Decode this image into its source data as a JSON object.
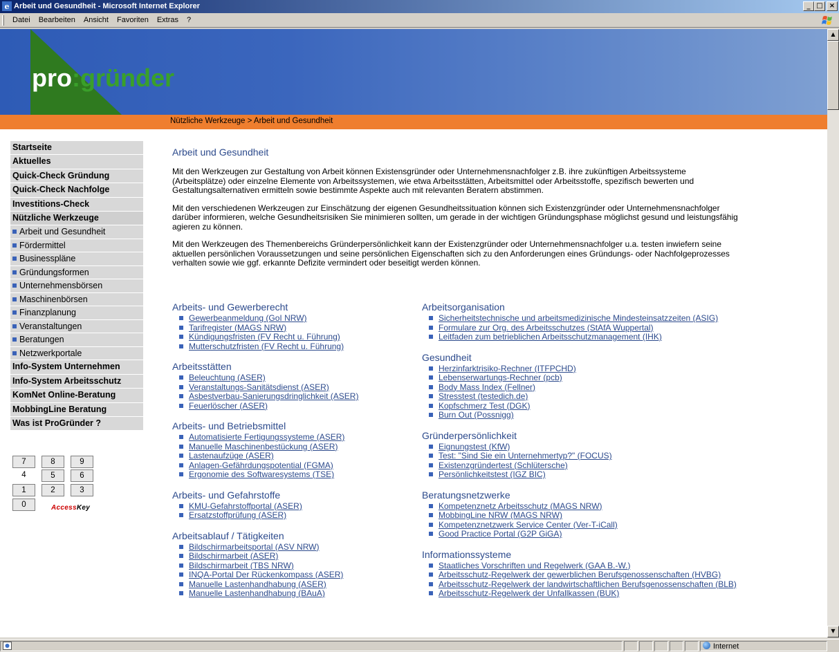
{
  "window": {
    "title": "Arbeit und Gesundheit - Microsoft Internet Explorer",
    "min": "_",
    "max": "□",
    "close": "×"
  },
  "menu": [
    "Datei",
    "Bearbeiten",
    "Ansicht",
    "Favoriten",
    "Extras",
    "?"
  ],
  "logo": {
    "pro": "pro",
    "rest": ":gründer"
  },
  "breadcrumb": "Nützliche Werkzeuge > Arbeit und Gesundheit",
  "nav": {
    "top1": [
      "Startseite",
      "Aktuelles",
      "Quick-Check Gründung",
      "Quick-Check Nachfolge",
      "Investitions-Check",
      "Nützliche Werkzeuge"
    ],
    "sub": [
      "Arbeit und Gesundheit",
      "Fördermittel",
      "Businesspläne",
      "Gründungsformen",
      "Unternehmensbörsen",
      "Maschinenbörsen",
      "Finanzplanung",
      "Veranstaltungen",
      "Beratungen",
      "Netzwerkportale"
    ],
    "top2": [
      "Info-System Unternehmen",
      "Info-System Arbeitsschutz",
      "KomNet Online-Beratung",
      "MobbingLine Beratung",
      "Was ist ProGründer ?"
    ]
  },
  "keypad": {
    "keys": [
      "7",
      "8",
      "9",
      "4",
      "5",
      "6",
      "1",
      "2",
      "3",
      "0"
    ],
    "label_a": "Access",
    "label_k": "Key"
  },
  "main": {
    "heading": "Arbeit und Gesundheit",
    "paragraphs": [
      "Mit den Werkzeugen zur Gestaltung von Arbeit können Existensgründer oder Unternehmensnachfolger z.B. ihre zukünftigen Arbeitssysteme (Arbeitsplätze) oder einzelne Elemente von Arbeitssystemen, wie etwa Arbeitsstätten, Arbeitsmittel oder Arbeitsstoffe, spezifisch bewerten und Gestaltungsalternativen ermitteln sowie bestimmte Aspekte auch mit relevanten Beratern abstimmen.",
      "Mit den verschiedenen Werkzeugen zur Einschätzung der eigenen Gesundheitssituation können sich Existenzgründer oder Unternehmensnachfolger darüber informieren, welche Gesundheitsrisiken Sie minimieren sollten, um gerade in der wichtigen Gründungsphase möglichst gesund und leistungsfähig agieren zu können.",
      "Mit den Werkzeugen des Themenbereichs Gründerpersönlichkeit kann der Existenzgründer oder Unternehmensnachfolger u.a. testen inwiefern seine aktuellen persönlichen Voraussetzungen und seine persönlichen Eigenschaften sich zu den Anforderungen eines Gründungs- oder Nachfolgeprozesses verhalten sowie wie ggf. erkannte Defizite vermindert oder beseitigt werden können."
    ],
    "left_sections": [
      {
        "title": "Arbeits- und Gewerberecht",
        "links": [
          "Gewerbeanmeldung (GoI NRW)",
          "Tarifregister (MAGS NRW)",
          "Kündigungsfristen (FV Recht u. Führung)",
          "Mutterschutzfristen (FV Recht u. Führung)"
        ]
      },
      {
        "title": "Arbeitsstätten",
        "links": [
          "Beleuchtung (ASER)",
          "Veranstaltungs-Sanitätsdienst (ASER)",
          "Asbestverbau-Sanierungsdringlichkeit (ASER)",
          "Feuerlöscher (ASER)"
        ]
      },
      {
        "title": "Arbeits- und Betriebsmittel",
        "links": [
          "Automatisierte Fertigungssysteme (ASER)",
          "Manuelle Maschinenbestückung (ASER)",
          "Lastenaufzüge (ASER)",
          "Anlagen-Gefährdungspotential (FGMA)",
          "Ergonomie des Softwaresystems (TSE)"
        ]
      },
      {
        "title": "Arbeits- und Gefahrstoffe",
        "links": [
          "KMU-Gefahrstoffportal (ASER)",
          "Ersatzstoffprüfung (ASER)"
        ]
      },
      {
        "title": "Arbeitsablauf / Tätigkeiten",
        "links": [
          "Bildschirmarbeitsportal (ASV NRW)",
          "Bildschirmarbeit (ASER)",
          "Bildschirmarbeit (TBS NRW)",
          "INQA-Portal Der Rückenkompass (ASER)",
          "Manuelle Lastenhandhabung (ASER)",
          "Manuelle Lastenhandhabung (BAuA)"
        ]
      }
    ],
    "right_sections": [
      {
        "title": "Arbeitsorganisation",
        "links": [
          "Sicherheitstechnische und arbeitsmedizinische Mindesteinsatzzeiten (ASIG)",
          "Formulare zur Org. des Arbeitsschutzes (StAfA Wuppertal)",
          "Leitfaden zum betrieblichen Arbeitsschutzmanagement (IHK)"
        ]
      },
      {
        "title": "Gesundheit",
        "links": [
          "Herzinfarktrisiko-Rechner (ITFPCHD)",
          "Lebenserwartungs-Rechner (pcb)",
          "Body Mass Index (Fellner)",
          "Stresstest (testedich.de)",
          "Kopfschmerz Test (DGK)",
          "Burn Out (Possnigg)"
        ]
      },
      {
        "title": "Gründerpersönlichkeit",
        "links": [
          "Eignungstest (KfW)",
          "Test: \"Sind Sie ein Unternehmertyp?\" (FOCUS)",
          "Existenzgründertest (Schlütersche)",
          "Persönlichkeitstest (IGZ BIC)"
        ]
      },
      {
        "title": "Beratungsnetzwerke",
        "links": [
          "Kompetenznetz Arbeitsschutz (MAGS NRW)",
          "MobbingLine NRW (MAGS NRW)",
          "Kompetenznetzwerk Service Center (Ver-T-iCall)",
          "Good Practice Portal (G2P GiGA)"
        ]
      },
      {
        "title": "Informationssysteme",
        "links": [
          "Staatliches Vorschriften und Regelwerk (GAA B.-W.)",
          "Arbeitsschutz-Regelwerk der gewerblichen Berufsgenossenschaften (HVBG)",
          "Arbeitsschutz-Regelwerk der landwirtschaftlichen Berufsgenossenschaften (BLB)",
          "Arbeitsschutz-Regelwerk der Unfallkassen (BUK)"
        ]
      }
    ]
  },
  "status": {
    "zone": "Internet"
  }
}
